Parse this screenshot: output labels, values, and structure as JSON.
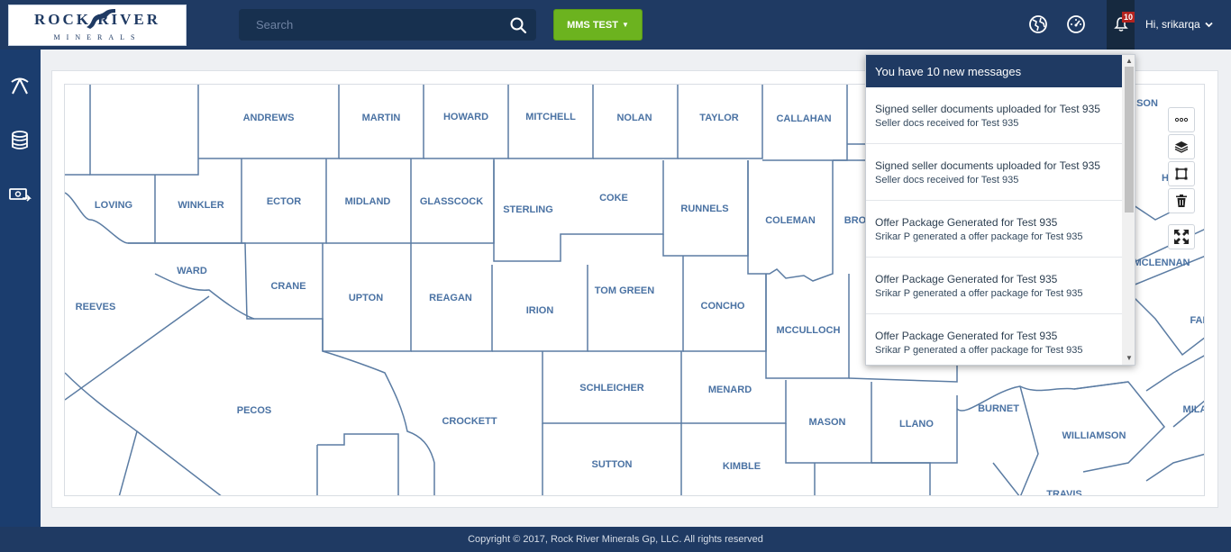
{
  "header": {
    "logo_text": "ROCK RIVER",
    "logo_subtext": "MINERALS",
    "search_placeholder": "Search",
    "project_selector": "MMS TEST",
    "notification_count": "10",
    "user_greeting": "Hi, srikarqa"
  },
  "sidebar": {
    "items": [
      {
        "icon": "pickaxe-icon"
      },
      {
        "icon": "coin-stack-icon"
      },
      {
        "icon": "money-exchange-icon"
      }
    ]
  },
  "map": {
    "counties": [
      {
        "name": "ANDREWS"
      },
      {
        "name": "MARTIN"
      },
      {
        "name": "HOWARD"
      },
      {
        "name": "MITCHELL"
      },
      {
        "name": "NOLAN"
      },
      {
        "name": "TAYLOR"
      },
      {
        "name": "CALLAHAN"
      },
      {
        "name": "LOVING"
      },
      {
        "name": "WINKLER"
      },
      {
        "name": "ECTOR"
      },
      {
        "name": "MIDLAND"
      },
      {
        "name": "GLASSCOCK"
      },
      {
        "name": "STERLING"
      },
      {
        "name": "COKE"
      },
      {
        "name": "RUNNELS"
      },
      {
        "name": "COLEMAN"
      },
      {
        "name": "BRO"
      },
      {
        "name": "WARD"
      },
      {
        "name": "CRANE"
      },
      {
        "name": "UPTON"
      },
      {
        "name": "REAGAN"
      },
      {
        "name": "IRION"
      },
      {
        "name": "TOM GREEN"
      },
      {
        "name": "CONCHO"
      },
      {
        "name": "MCCULLOCH"
      },
      {
        "name": "REEVES"
      },
      {
        "name": "PECOS"
      },
      {
        "name": "CROCKETT"
      },
      {
        "name": "SCHLEICHER"
      },
      {
        "name": "MENARD"
      },
      {
        "name": "MASON"
      },
      {
        "name": "LLANO"
      },
      {
        "name": "BURNET"
      },
      {
        "name": "WILLIAMSON"
      },
      {
        "name": "SUTTON"
      },
      {
        "name": "KIMBLE"
      },
      {
        "name": "TRAVIS"
      },
      {
        "name": "MCLENNAN"
      },
      {
        "name": "SON"
      },
      {
        "name": "H"
      },
      {
        "name": "FAI"
      },
      {
        "name": "MILA"
      }
    ],
    "tools": [
      {
        "icon": "more-options-icon"
      },
      {
        "icon": "layers-icon"
      },
      {
        "icon": "draw-polygon-icon"
      },
      {
        "icon": "trash-icon"
      },
      {
        "icon": "fullscreen-icon"
      }
    ]
  },
  "notifications": {
    "header": "You have 10 new messages",
    "items": [
      {
        "title": "Signed seller documents uploaded for Test 935",
        "subtitle": "Seller docs received for Test 935"
      },
      {
        "title": "Signed seller documents uploaded for Test 935",
        "subtitle": "Seller docs received for Test 935"
      },
      {
        "title": "Offer Package Generated for Test 935",
        "subtitle": "Srikar P generated a offer package for Test 935"
      },
      {
        "title": "Offer Package Generated for Test 935",
        "subtitle": "Srikar P generated a offer package for Test 935"
      },
      {
        "title": "Offer Package Generated for Test 935",
        "subtitle": "Srikar P generated a offer package for Test 935"
      }
    ]
  },
  "footer": {
    "copyright": "Copyright © 2017, Rock River Minerals Gp, LLC. All rights reserved"
  }
}
